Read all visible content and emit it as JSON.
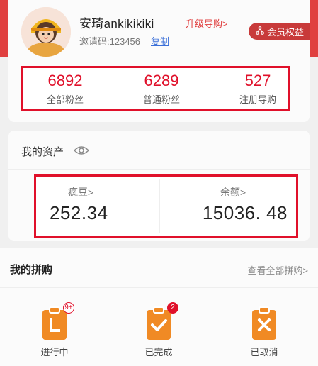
{
  "profile": {
    "username": "安琦ankikikiki",
    "upgrade_label": "升级导购",
    "upgrade_chevron": ">",
    "invite_label": "邀请码:",
    "invite_code": "123456",
    "copy_label": "复制",
    "member_label": "会员权益"
  },
  "stats": [
    {
      "value": "6892",
      "label": "全部粉丝"
    },
    {
      "value": "6289",
      "label": "普通粉丝"
    },
    {
      "value": "527",
      "label": "注册导购"
    }
  ],
  "assets": {
    "title": "我的资产",
    "beans_label": "疯豆",
    "beans_value": "252.34",
    "balance_label": "余额",
    "balance_value": "15036. 48",
    "chevron": ">"
  },
  "group_buy": {
    "title": "我的拼购",
    "view_all": "查看全部拼购",
    "chevron": ">",
    "orders": [
      {
        "label": "进行中",
        "badge": "9+",
        "icon": "clipboard-l-icon"
      },
      {
        "label": "已完成",
        "badge": "2",
        "icon": "clipboard-check-icon"
      },
      {
        "label": "已取消",
        "badge": "",
        "icon": "clipboard-x-icon"
      }
    ]
  },
  "colors": {
    "brand_red": "#e04040",
    "highlight_red": "#e0102a",
    "icon_orange": "#f08a24",
    "link_blue": "#3a6fd8"
  }
}
